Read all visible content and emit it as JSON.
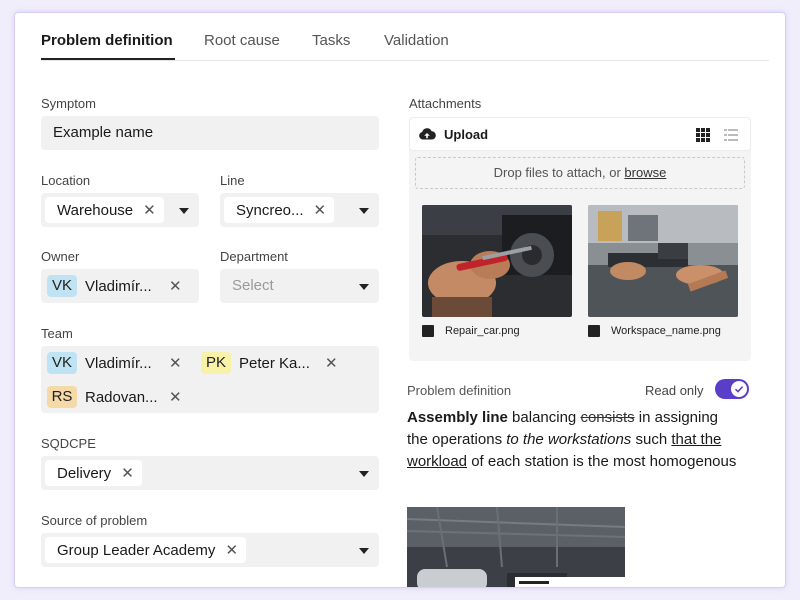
{
  "tabs": [
    {
      "label": "Problem definition",
      "active": true
    },
    {
      "label": "Root cause"
    },
    {
      "label": "Tasks"
    },
    {
      "label": "Validation"
    }
  ],
  "form": {
    "symptom": {
      "label": "Symptom",
      "value": "Example name"
    },
    "location": {
      "label": "Location",
      "value": "Warehouse"
    },
    "line": {
      "label": "Line",
      "value": "Syncreo..."
    },
    "owner": {
      "label": "Owner",
      "initials": "VK",
      "name": "Vladimír..."
    },
    "department": {
      "label": "Department",
      "placeholder": "Select"
    },
    "team": {
      "label": "Team",
      "members": [
        {
          "initials": "VK",
          "name": "Vladimír...",
          "color": "#bfe3f2"
        },
        {
          "initials": "PK",
          "name": "Peter Ka...",
          "color": "#f7f2a8"
        },
        {
          "initials": "RS",
          "name": "Radovan...",
          "color": "#f5d9a6"
        }
      ]
    },
    "sqdcpe": {
      "label": "SQDCPE",
      "value": "Delivery"
    },
    "source": {
      "label": "Source of problem",
      "value": "Group Leader Academy"
    },
    "remove_glyph": "✕"
  },
  "attachments": {
    "label": "Attachments",
    "upload_label": "Upload",
    "drop_text": "Drop files to attach, or ",
    "browse_label": "browse",
    "files": [
      {
        "name": "Repair_car.png"
      },
      {
        "name": "Workspace_name.png"
      }
    ]
  },
  "problem_definition": {
    "label": "Problem definition",
    "readonly_label": "Read only",
    "readonly": true,
    "text": {
      "bold": "Assembly line",
      "t1": " balancing ",
      "strike": "consists",
      "t2": " in assigning the operations ",
      "italic": "to the workstations",
      "t3": " such ",
      "underline": "that the workload",
      "t4": " of each station is the most homogenous"
    }
  },
  "colors": {
    "accent": "#5b3ec8",
    "owner_avatar": "#bfe3f2"
  }
}
